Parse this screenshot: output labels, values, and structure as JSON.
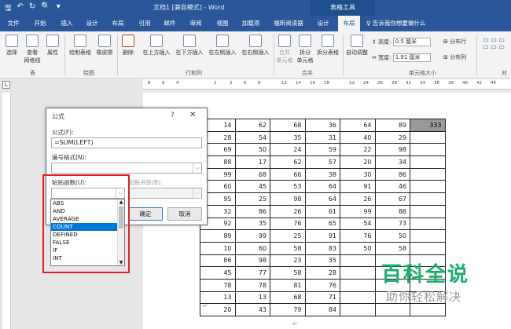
{
  "title_bar": {
    "doc_title": "文档1 [兼容模式] - Word",
    "context_tab": "表格工具",
    "qat_icons": [
      "save-icon",
      "undo-icon",
      "redo-icon",
      "print-preview-icon",
      "qat-more-icon"
    ]
  },
  "menu": {
    "tabs": [
      "文件",
      "开始",
      "插入",
      "设计",
      "布局",
      "引用",
      "邮件",
      "审阅",
      "视图",
      "加载项",
      "福昕阅读器",
      "设计",
      "布局"
    ],
    "active_index": 12,
    "tell_me": "♀ 告诉我你想要做什么"
  },
  "ribbon": {
    "table_group": {
      "buttons": [
        "选择",
        "查看\n网格线",
        "属性"
      ],
      "label": "表"
    },
    "draw_group": {
      "buttons": [
        "绘制表格",
        "橡皮擦"
      ],
      "label": "绘图"
    },
    "rowscols_group": {
      "buttons": [
        "删除",
        "在上方插入",
        "在下方插入",
        "在左侧插入",
        "在右侧插入"
      ],
      "label": "行和列"
    },
    "merge_group": {
      "buttons": [
        "合并\n单元格",
        "拆分\n单元格",
        "拆分表格"
      ],
      "label": "合并"
    },
    "autofit": "自动调整",
    "cellsize_group": {
      "height_label": "高度:",
      "height_value": "0.5 厘米",
      "width_label": "宽度:",
      "width_value": "1.91 厘米",
      "dist_rows": "分布行",
      "dist_cols": "分布列",
      "label": "单元格大小"
    },
    "align_group_label": "对"
  },
  "ruler": {
    "tab_marker": "L",
    "numbers": [
      "8",
      "6",
      "4",
      "2",
      "2",
      "6",
      "8",
      "12",
      "14",
      "16",
      "18",
      "22",
      "24",
      "26",
      "28",
      "32",
      "34",
      "36",
      "38",
      "40",
      "42",
      "44"
    ]
  },
  "table": {
    "rows": [
      [
        "14",
        "62",
        "68",
        "36",
        "64",
        "89",
        "333"
      ],
      [
        "28",
        "54",
        "35",
        "31",
        "40",
        "29",
        ""
      ],
      [
        "69",
        "50",
        "24",
        "59",
        "22",
        "98",
        ""
      ],
      [
        "88",
        "17",
        "62",
        "57",
        "20",
        "34",
        ""
      ],
      [
        "99",
        "68",
        "66",
        "38",
        "30",
        "86",
        ""
      ],
      [
        "60",
        "45",
        "53",
        "64",
        "91",
        "46",
        ""
      ],
      [
        "95",
        "25",
        "98",
        "64",
        "26",
        "67",
        ""
      ],
      [
        "32",
        "86",
        "26",
        "61",
        "99",
        "88",
        ""
      ],
      [
        "92",
        "35",
        "76",
        "65",
        "54",
        "73",
        ""
      ],
      [
        "89",
        "99",
        "25",
        "91",
        "76",
        "50",
        ""
      ],
      [
        "10",
        "60",
        "58",
        "83",
        "50",
        "58",
        ""
      ],
      [
        "86",
        "98",
        "23",
        "35",
        "",
        "",
        ""
      ],
      [
        "45",
        "77",
        "58",
        "28",
        "",
        "",
        ""
      ],
      [
        "78",
        "78",
        "81",
        "76",
        "",
        "",
        ""
      ],
      [
        "13",
        "13",
        "68",
        "71",
        "",
        "",
        ""
      ],
      [
        "20",
        "43",
        "79",
        "84",
        "",
        "",
        ""
      ]
    ]
  },
  "dialog": {
    "title": "公式",
    "help": "?",
    "close": "✕",
    "formula_label": "公式(F):",
    "formula_value": "=SUM(LEFT)",
    "number_format_label": "编号格式(N):",
    "paste_function_label": "粘贴函数(U):",
    "paste_bookmark_label": "粘贴书签(B):",
    "ok": "确定",
    "cancel": "取消",
    "functions": [
      "ABS",
      "AND",
      "AVERAGE",
      "COUNT",
      "DEFINED",
      "FALSE",
      "IF",
      "INT"
    ],
    "selected_function": "COUNT"
  },
  "watermark": {
    "title": "百科全说",
    "subtitle": "助你轻松解决"
  },
  "colors": {
    "accent": "#2b579a",
    "highlight": "#0078d7",
    "callout": "#e02020",
    "watermark": "#19b06a"
  }
}
